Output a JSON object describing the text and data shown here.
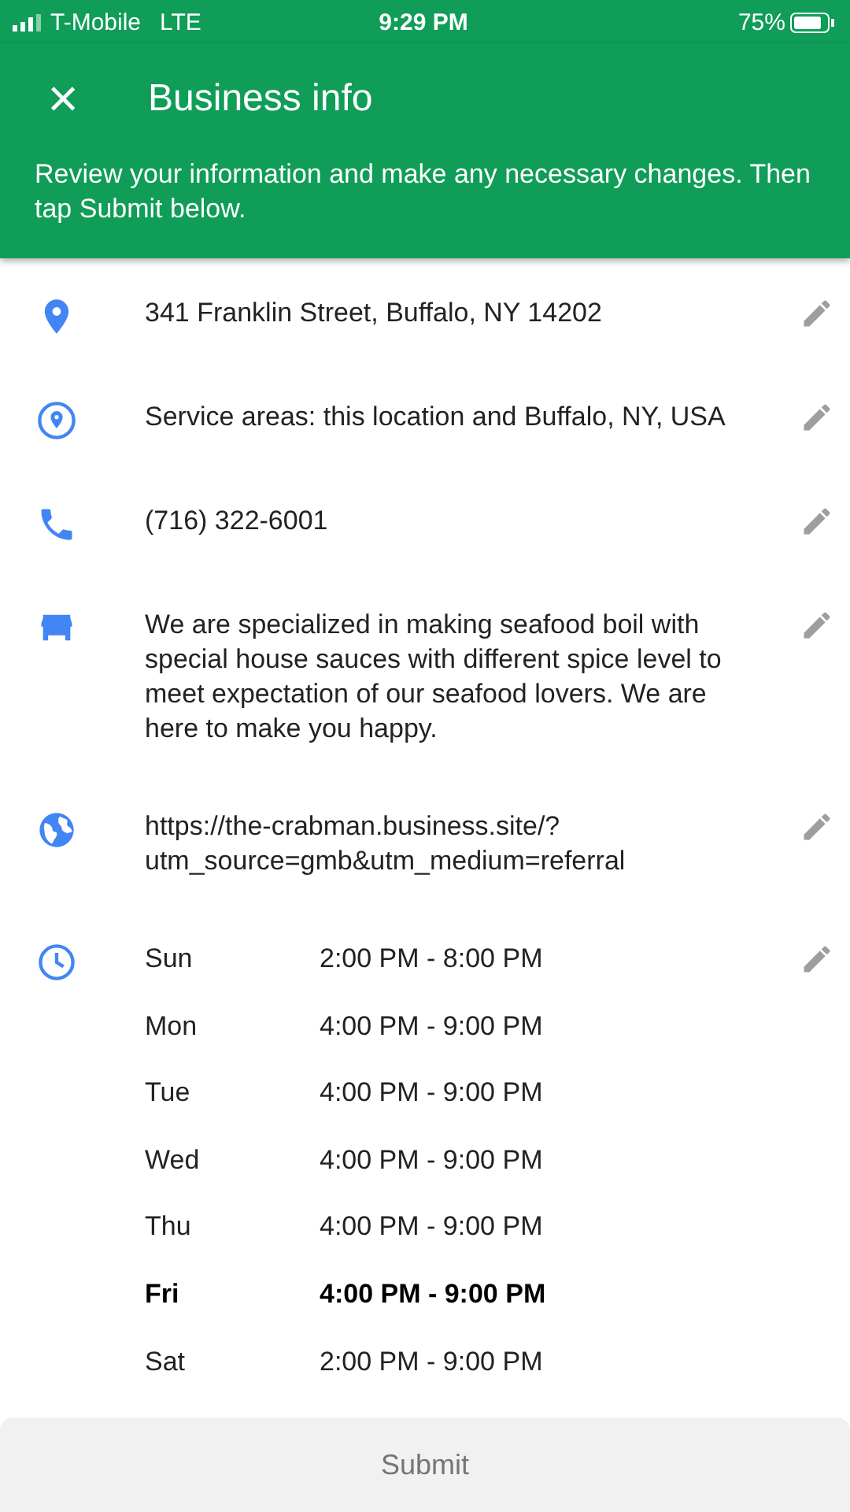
{
  "status_bar": {
    "carrier": "T-Mobile",
    "network": "LTE",
    "time": "9:29 PM",
    "battery": "75%"
  },
  "header": {
    "close": "×",
    "title": "Business info",
    "subtitle": "Review your information and make any necessary changes. Then tap Submit below."
  },
  "rows": [
    {
      "kind": "address",
      "text": "341 Franklin Street, Buffalo, NY 14202"
    },
    {
      "kind": "service_area",
      "text": "Service areas: this location and Buffalo, NY, USA"
    },
    {
      "kind": "phone",
      "text": "(716) 322-6001"
    },
    {
      "kind": "description",
      "text": "We are specialized in making seafood boil with special house sauces with different spice level to meet expectation of our seafood lovers. We are here to make you happy."
    },
    {
      "kind": "website",
      "text": "https://the-crabman.business.site/?utm_source=gmb&utm_medium=referral"
    },
    {
      "kind": "hours",
      "days": [
        {
          "day": "Sun",
          "hours": "2:00 PM - 8:00 PM",
          "today": false
        },
        {
          "day": "Mon",
          "hours": "4:00 PM - 9:00 PM",
          "today": false
        },
        {
          "day": "Tue",
          "hours": "4:00 PM - 9:00 PM",
          "today": false
        },
        {
          "day": "Wed",
          "hours": "4:00 PM - 9:00 PM",
          "today": false
        },
        {
          "day": "Thu",
          "hours": "4:00 PM - 9:00 PM",
          "today": false
        },
        {
          "day": "Fri",
          "hours": "4:00 PM - 9:00 PM",
          "today": true
        },
        {
          "day": "Sat",
          "hours": "2:00 PM - 9:00 PM",
          "today": false
        }
      ]
    }
  ],
  "submit": {
    "label": "Submit",
    "disabled": true
  }
}
